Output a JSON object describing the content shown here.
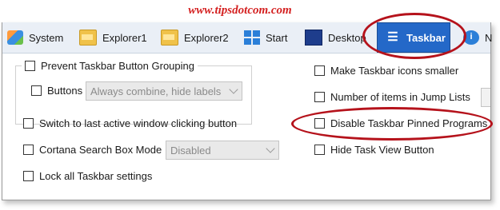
{
  "watermark": "www.tipsdotcom.com",
  "tabs": [
    {
      "label": "System",
      "icon": "system-icon"
    },
    {
      "label": "Explorer1",
      "icon": "folder-icon"
    },
    {
      "label": "Explorer2",
      "icon": "folder-icon"
    },
    {
      "label": "Start",
      "icon": "windows-start-icon"
    },
    {
      "label": "Desktop",
      "icon": "desktop-icon"
    },
    {
      "label": "Taskbar",
      "icon": "taskbar-list-icon",
      "active": true
    },
    {
      "label": "N",
      "icon": "info-icon"
    }
  ],
  "left": {
    "prevent_grouping": "Prevent Taskbar Button Grouping",
    "buttons_label": "Buttons",
    "buttons_select": "Always combine, hide labels",
    "switch_last": "Switch to last active window clicking button",
    "cortana_label": "Cortana Search Box Mode",
    "cortana_select": "Disabled",
    "lock_all": "Lock all Taskbar settings"
  },
  "right": {
    "small_icons": "Make Taskbar icons smaller",
    "jump_lists": "Number of items in Jump Lists",
    "disable_pinned": "Disable Taskbar Pinned Programs",
    "hide_task_view": "Hide Task View Button"
  },
  "colors": {
    "active_tab": "#2468c8",
    "highlight_ellipse": "#b5121b",
    "watermark": "#d42020"
  }
}
